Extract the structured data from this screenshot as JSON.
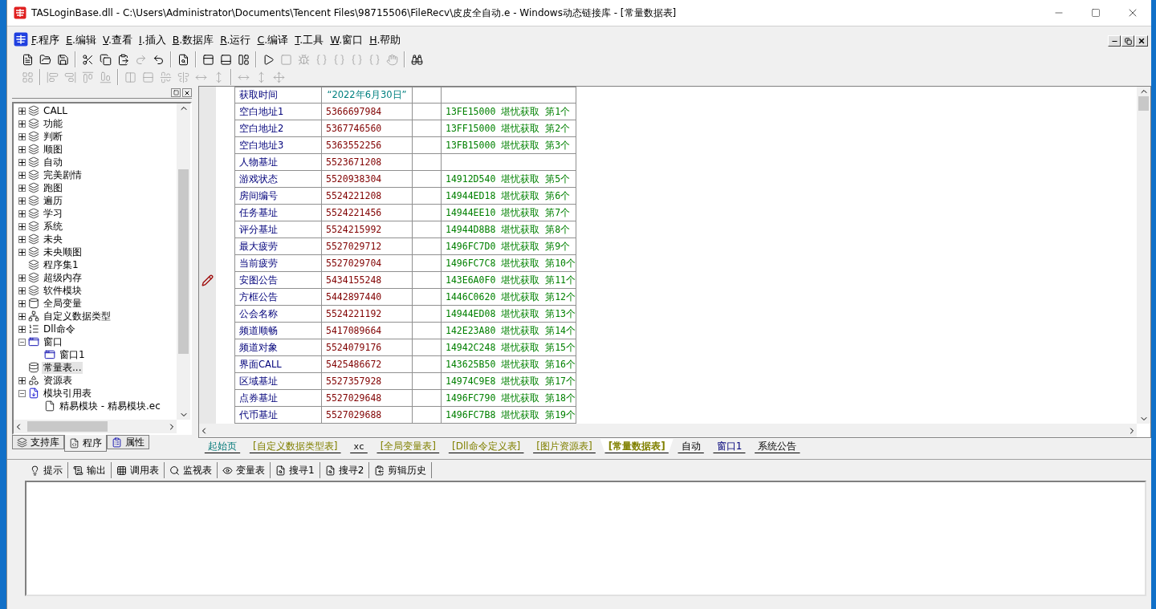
{
  "window": {
    "title": "TASLoginBase.dll - C:\\Users\\Administrator\\Documents\\Tencent Files\\98715506\\FileRecv\\皮皮全自动.e - Windows动态链接库 - [常量数据表]"
  },
  "menu": [
    "F.程序",
    "E.编辑",
    "V.查看",
    "I.插入",
    "B.数据库",
    "R.运行",
    "C.编译",
    "T.工具",
    "W.窗口",
    "H.帮助"
  ],
  "toolbar_1": [
    [
      {
        "disabled": false
      },
      {
        "disabled": false
      },
      {
        "disabled": false
      }
    ],
    [
      {
        "disabled": false
      },
      {
        "disabled": false
      },
      {
        "disabled": false
      },
      {
        "disabled": true
      },
      {
        "disabled": false
      }
    ],
    [
      {
        "disabled": false
      }
    ],
    [
      {
        "disabled": false
      },
      {
        "disabled": false
      },
      {
        "disabled": false
      }
    ],
    [
      {
        "disabled": false
      },
      {
        "disabled": true
      },
      {
        "disabled": true
      },
      {
        "disabled": true
      },
      {
        "disabled": true
      },
      {
        "disabled": true
      },
      {
        "disabled": true
      },
      {
        "disabled": true
      }
    ],
    [
      {
        "disabled": false
      }
    ]
  ],
  "toolbar_2": [
    [
      {
        "disabled": true
      }
    ],
    [
      {
        "disabled": true
      },
      {
        "disabled": true
      },
      {
        "disabled": true
      },
      {
        "disabled": true
      }
    ],
    [
      {
        "disabled": true
      },
      {
        "disabled": true
      },
      {
        "disabled": true
      },
      {
        "disabled": true
      },
      {
        "disabled": true
      },
      {
        "disabled": true
      }
    ],
    [
      {
        "disabled": true
      },
      {
        "disabled": true
      },
      {
        "disabled": true
      }
    ]
  ],
  "tree": [
    {
      "label": "CALL",
      "kind": "module",
      "expanded": false,
      "selected": false
    },
    {
      "label": "功能",
      "kind": "module",
      "expanded": false,
      "selected": false
    },
    {
      "label": "判断",
      "kind": "module",
      "expanded": false,
      "selected": false
    },
    {
      "label": "顺图",
      "kind": "module",
      "expanded": false,
      "selected": false
    },
    {
      "label": "自动",
      "kind": "module",
      "expanded": false,
      "selected": false
    },
    {
      "label": "完美剧情",
      "kind": "module",
      "expanded": false,
      "selected": false
    },
    {
      "label": "跑图",
      "kind": "module",
      "expanded": false,
      "selected": false
    },
    {
      "label": "遍历",
      "kind": "module",
      "expanded": false,
      "selected": false
    },
    {
      "label": "学习",
      "kind": "module",
      "expanded": false,
      "selected": false
    },
    {
      "label": "系统",
      "kind": "module",
      "expanded": false,
      "selected": false
    },
    {
      "label": "未央",
      "kind": "module",
      "expanded": false,
      "selected": false
    },
    {
      "label": "未央顺图",
      "kind": "module",
      "expanded": false,
      "selected": false
    },
    {
      "label": "程序集1",
      "kind": "module",
      "selected": false
    },
    {
      "label": "超级内存",
      "kind": "module",
      "expanded": false,
      "selected": false
    },
    {
      "label": "软件模块",
      "kind": "module",
      "expanded": false,
      "selected": false
    },
    {
      "label": "全局变量",
      "kind": "variable",
      "expanded": false,
      "selected": false
    },
    {
      "label": "自定义数据类型",
      "kind": "type",
      "expanded": false,
      "selected": false
    },
    {
      "label": "Dll命令",
      "kind": "dll",
      "expanded": false,
      "selected": false
    },
    {
      "label": "窗口",
      "kind": "window",
      "expanded": true,
      "selected": false,
      "children": [
        {
          "label": "窗口1",
          "kind": "window",
          "selected": false
        }
      ]
    },
    {
      "label": "常量表...",
      "kind": "constant",
      "selected": true
    },
    {
      "label": "资源表",
      "kind": "resource",
      "expanded": false,
      "selected": false
    },
    {
      "label": "模块引用表",
      "kind": "reference",
      "expanded": true,
      "selected": false,
      "children": [
        {
          "label": "精易模块 - 精易模块.ec",
          "kind": "file",
          "selected": false
        }
      ]
    }
  ],
  "panel_tabs": [
    {
      "label": "支持库",
      "selected": false
    },
    {
      "label": "程序",
      "selected": true
    },
    {
      "label": "属性",
      "selected": false
    }
  ],
  "constants": [
    {
      "name": "获取时间",
      "value": "“2022年6月30日”",
      "kind": "text",
      "current": false
    },
    {
      "name": "空白地址1",
      "value": "5366697984",
      "kind": "number",
      "comment": "13FE15000 堪忧获取 第1个",
      "current": false
    },
    {
      "name": "空白地址2",
      "value": "5367746560",
      "kind": "number",
      "comment": "13FF15000 堪忧获取 第2个",
      "current": false
    },
    {
      "name": "空白地址3",
      "value": "5363552256",
      "kind": "number",
      "comment": "13FB15000 堪忧获取 第3个",
      "current": false
    },
    {
      "name": "人物基址",
      "value": "5523671208",
      "kind": "number",
      "current": false
    },
    {
      "name": "游戏状态",
      "value": "5520938304",
      "kind": "number",
      "comment": "14912D540 堪忧获取 第5个",
      "current": false
    },
    {
      "name": "房间编号",
      "value": "5524221208",
      "kind": "number",
      "comment": "14944ED18 堪忧获取 第6个",
      "current": false
    },
    {
      "name": "任务基址",
      "value": "5524221456",
      "kind": "number",
      "comment": "14944EE10 堪忧获取 第7个",
      "current": false
    },
    {
      "name": "评分基址",
      "value": "5524215992",
      "kind": "number",
      "comment": "14944D8B8 堪忧获取 第8个",
      "current": false
    },
    {
      "name": "最大疲劳",
      "value": "5527029712",
      "kind": "number",
      "comment": "1496FC7D0 堪忧获取 第9个",
      "current": false
    },
    {
      "name": "当前疲劳",
      "value": "5527029704",
      "kind": "number",
      "comment": "1496FC7C8 堪忧获取 第10个",
      "current": false
    },
    {
      "name": "安图公告",
      "value": "5434155248",
      "kind": "number",
      "comment": "143E6A0F0 堪忧获取 第11个",
      "current": true
    },
    {
      "name": "方框公告",
      "value": "5442897440",
      "kind": "number",
      "comment": "1446C0620 堪忧获取 第12个",
      "current": false
    },
    {
      "name": "公会名称",
      "value": "5524221192",
      "kind": "number",
      "comment": "14944ED08 堪忧获取 第13个",
      "current": false
    },
    {
      "name": "频道顺畅",
      "value": "5417089664",
      "kind": "number",
      "comment": "142E23A80 堪忧获取 第14个",
      "current": false
    },
    {
      "name": "频道对象",
      "value": "5524079176",
      "kind": "number",
      "comment": "14942C248 堪忧获取 第15个",
      "current": false
    },
    {
      "name": "界面CALL",
      "value": "5425486672",
      "kind": "number",
      "comment": "143625B50 堪忧获取 第16个",
      "current": false
    },
    {
      "name": "区域基址",
      "value": "5527357928",
      "kind": "number",
      "comment": "14974C9E8 堪忧获取 第17个",
      "current": false
    },
    {
      "name": "点券基址",
      "value": "5527029648",
      "kind": "number",
      "comment": "1496FC790 堪忧获取 第18个",
      "current": false
    },
    {
      "name": "代币基址",
      "value": "5527029688",
      "kind": "number",
      "comment": "1496FC7B8 堪忧获取 第19个",
      "current": false
    }
  ],
  "editor_tabs": [
    {
      "label": "起始页",
      "kind": "start",
      "selected": false
    },
    {
      "label": "[自定义数据类型表]",
      "kind": "table",
      "selected": false
    },
    {
      "label": "xc",
      "kind": "code",
      "selected": false
    },
    {
      "label": "[全局变量表]",
      "kind": "table",
      "selected": false
    },
    {
      "label": "[Dll命令定义表]",
      "kind": "table",
      "selected": false
    },
    {
      "label": "[图片资源表]",
      "kind": "table",
      "selected": false
    },
    {
      "label": "[常量数据表]",
      "kind": "table",
      "selected": true
    },
    {
      "label": "自动",
      "kind": "module",
      "selected": false
    },
    {
      "label": "窗口1",
      "kind": "window",
      "selected": false
    },
    {
      "label": "系统公告",
      "kind": "module",
      "selected": false
    }
  ],
  "output_tabs": [
    "提示",
    "输出",
    "调用表",
    "监视表",
    "变量表",
    "搜寻1",
    "搜寻2",
    "剪辑历史"
  ]
}
